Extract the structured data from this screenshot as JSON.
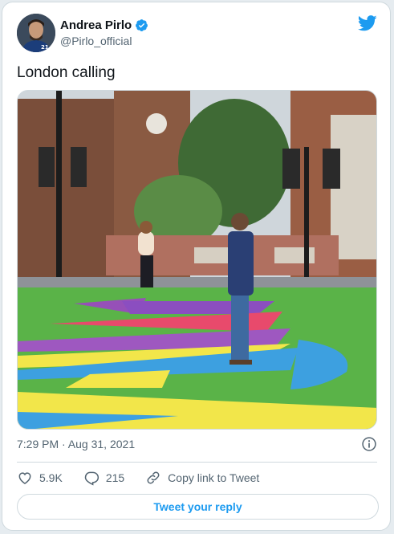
{
  "author": {
    "display_name": "Andrea Pirlo",
    "handle": "@Pirlo_official",
    "verified": true,
    "avatar_icon": "avatar"
  },
  "tweet": {
    "text": "London calling",
    "timestamp": "7:29 PM · Aug 31, 2021"
  },
  "actions": {
    "likes": "5.9K",
    "replies": "215",
    "copy_link": "Copy link to Tweet"
  },
  "reply_button": "Tweet your reply",
  "colors": {
    "accent": "#1d9bf0",
    "text": "#0f1419",
    "secondary": "#536471",
    "border": "#cfd9de"
  },
  "icons": [
    "twitter-bird-icon",
    "verified-badge-icon",
    "info-icon",
    "heart-icon",
    "comment-icon",
    "link-icon"
  ]
}
